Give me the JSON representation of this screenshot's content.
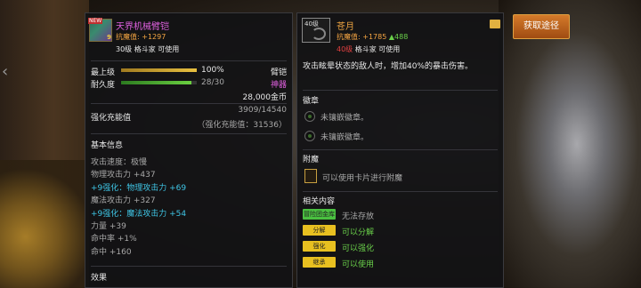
{
  "left": {
    "item_name": "天界机械臂铠",
    "new_badge": "NEW",
    "item_level_badge": "9",
    "resistance_label": "抗魔值:",
    "resistance_value": "+1297",
    "req": "30级 格斗家 可使用",
    "upgrade_label": "最上级",
    "upgrade_value": "100%",
    "upgrade_progress": 1.0,
    "slot_type": "臂铠",
    "durability_label": "耐久度",
    "durability_value": "28/30",
    "durability_progress": 0.933,
    "rarity": "神器",
    "price": "28,000金币",
    "amp_label": "强化充能值",
    "amp_value": "3909/14540",
    "amp_bonus": "（强化充能值：31536）",
    "basic_info_title": "基本信息",
    "stats": [
      {
        "text": "攻击速度：极慢",
        "color": "gray"
      },
      {
        "text": "物理攻击力 +437",
        "color": "gray"
      },
      {
        "text": "+9强化：物理攻击力 +69",
        "color": "cyan"
      },
      {
        "text": "魔法攻击力 +327",
        "color": "gray"
      },
      {
        "text": "+9强化：魔法攻击力 +54",
        "color": "cyan"
      },
      {
        "text": "力量 +39",
        "color": "gray"
      },
      {
        "text": "命中率 +1%",
        "color": "gray"
      },
      {
        "text": "命中 +160",
        "color": "gray"
      }
    ],
    "effect_title": "效果"
  },
  "right": {
    "icon_level": "40级",
    "item_name": "苍月",
    "resistance_label": "抗魔值:",
    "resistance_value": "+1785",
    "resistance_delta": "▲488",
    "req_level": "40级",
    "req_rest": "格斗家 可使用",
    "description": "攻击眩晕状态的敌人时，增加40%的暴击伤害。",
    "emblem_title": "徽章",
    "emblems": [
      "未镶嵌徽章。",
      "未镶嵌徽章。"
    ],
    "enchant_title": "附魔",
    "enchant_text": "可以使用卡片进行附魔",
    "related_title": "相关内容",
    "related": [
      {
        "tag": "冒险团金库",
        "text": "无法存放",
        "tag_color": "green",
        "text_color": "gray"
      },
      {
        "tag": "分解",
        "text": "可以分解",
        "tag_color": "yellow",
        "text_color": "green"
      },
      {
        "tag": "强化",
        "text": "可以强化",
        "tag_color": "yellow",
        "text_color": "green"
      },
      {
        "tag": "继承",
        "text": "可以使用",
        "tag_color": "yellow",
        "text_color": "green"
      }
    ]
  },
  "get_button": "获取途径",
  "colors": {
    "title": "#e061e0",
    "resistance": "#f5a542",
    "green": "#6ad04a",
    "cyan": "#3fc6e6",
    "button": "#c8661e"
  }
}
